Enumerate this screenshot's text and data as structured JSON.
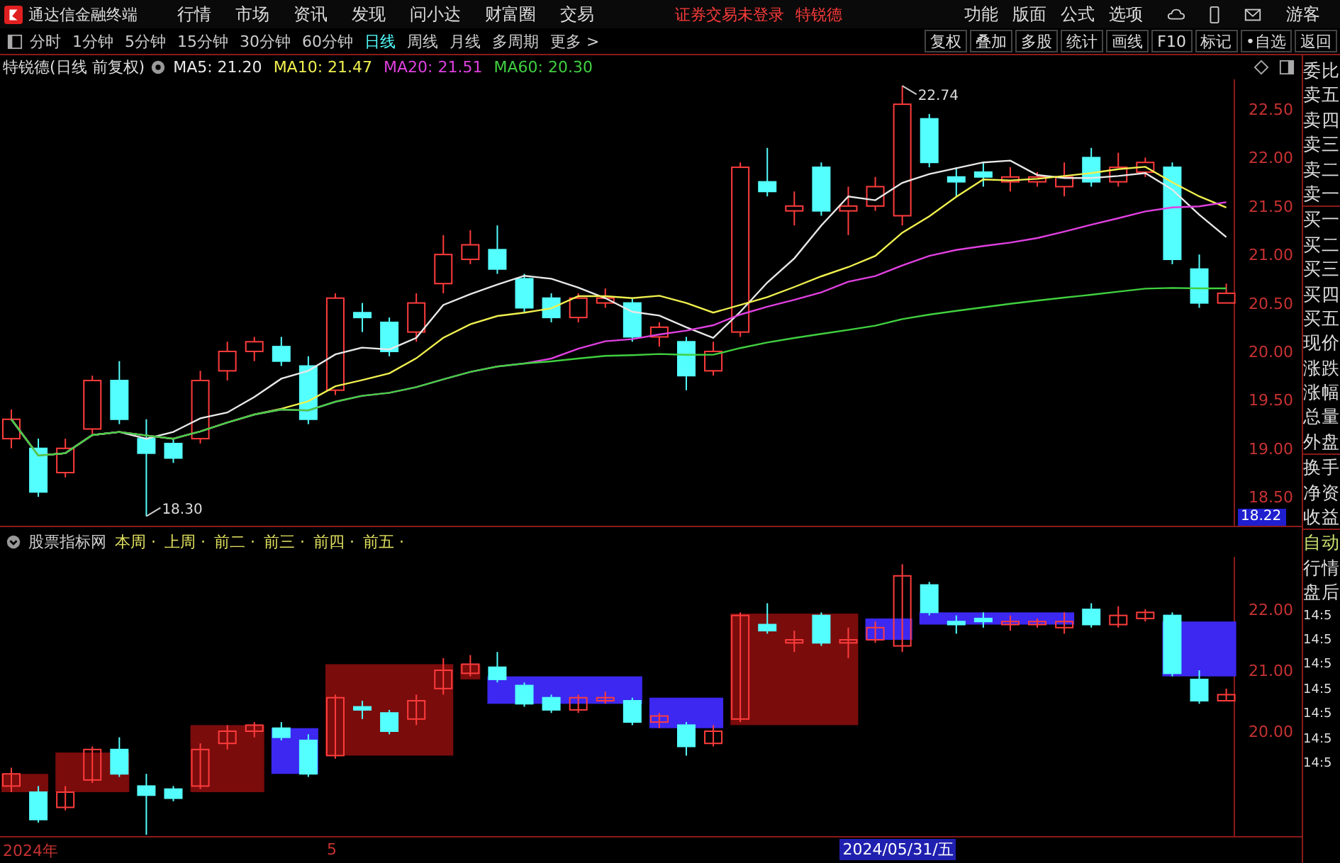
{
  "app": {
    "title": "通达信金融终端"
  },
  "menu": [
    "行情",
    "市场",
    "资讯",
    "发现",
    "问小达",
    "财富圈",
    "交易"
  ],
  "login_status": "证券交易未登录",
  "stock_name": "特锐德",
  "right_menu": [
    "功能",
    "版面",
    "公式",
    "选项"
  ],
  "user": "游客",
  "periods": [
    {
      "label": "分时",
      "selected": false
    },
    {
      "label": "1分钟",
      "selected": false
    },
    {
      "label": "5分钟",
      "selected": false
    },
    {
      "label": "15分钟",
      "selected": false
    },
    {
      "label": "30分钟",
      "selected": false
    },
    {
      "label": "60分钟",
      "selected": false
    },
    {
      "label": "日线",
      "selected": true
    },
    {
      "label": "周线",
      "selected": false
    },
    {
      "label": "月线",
      "selected": false
    },
    {
      "label": "多周期",
      "selected": false
    },
    {
      "label": "更多 >",
      "selected": false
    }
  ],
  "tools": [
    "复权",
    "叠加",
    "多股",
    "统计",
    "画线",
    "F10",
    "标记",
    "•自选",
    "返回"
  ],
  "info": {
    "title": "特锐德(日线 前复权)",
    "ma": [
      {
        "label": "MA5: 21.20",
        "color": "#e8e8e8"
      },
      {
        "label": "MA10: 21.47",
        "color": "#f0f050"
      },
      {
        "label": "MA20: 21.51",
        "color": "#e040e0"
      },
      {
        "label": "MA60: 20.30",
        "color": "#40d040"
      }
    ]
  },
  "main_chart": {
    "price_axis": [
      "22.50",
      "22.00",
      "21.50",
      "21.00",
      "20.50",
      "20.00",
      "19.50",
      "19.00",
      "18.50"
    ],
    "high_label": "22.74",
    "low_label": "18.30",
    "cursor_price": "18.22"
  },
  "indicator": {
    "name": "股票指标网",
    "weeks": [
      "本周 ·",
      "上周 ·",
      "前二 ·",
      "前三 ·",
      "前四 ·",
      "前五 ·"
    ],
    "price_axis": [
      "22.00",
      "21.00",
      "20.00"
    ],
    "date_labels": [
      "2024年",
      "5"
    ],
    "cursor_date": "2024/05/31/五"
  },
  "side_panel": {
    "quote_labels": [
      "委比",
      "卖五",
      "卖四",
      "卖三",
      "卖二",
      "卖一",
      "买一",
      "买二",
      "买三",
      "买四",
      "买五",
      "现价",
      "涨跌",
      "涨幅",
      "总量",
      "外盘",
      "换手",
      "净资",
      "收益"
    ],
    "auto_label": "自动",
    "status_labels": [
      "行情",
      "盘后"
    ],
    "times": [
      "14:5",
      "14:5",
      "14:5",
      "14:5",
      "14:5",
      "14:5",
      "14:5"
    ]
  }
}
